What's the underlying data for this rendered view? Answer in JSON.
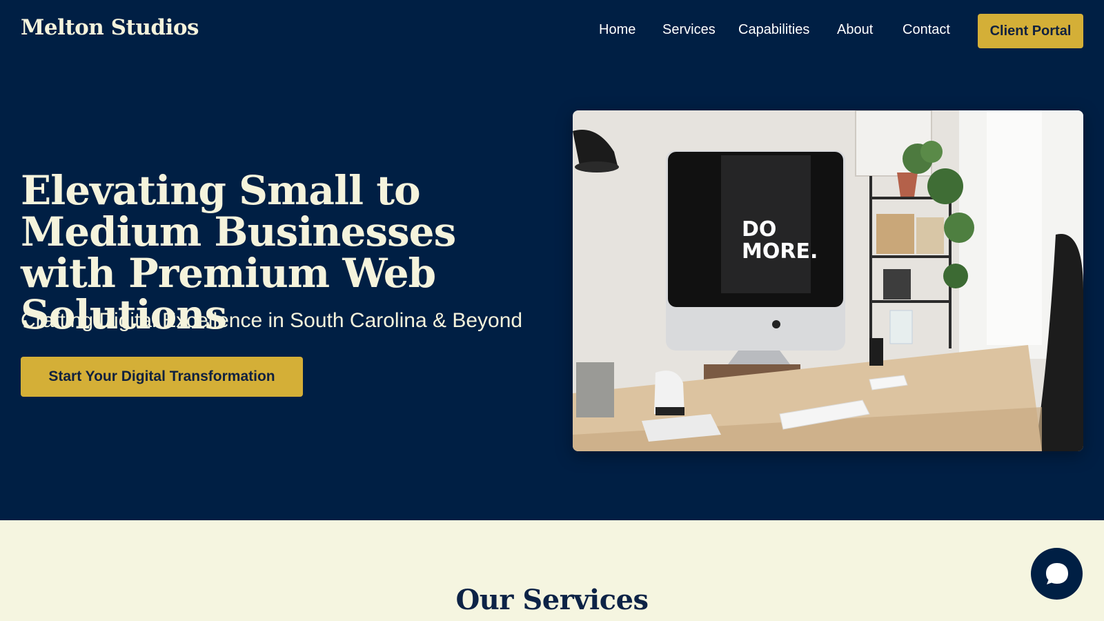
{
  "nav": {
    "brand": "Melton Studios",
    "links": [
      "Home",
      "Services",
      "Capabilities",
      "About",
      "Contact"
    ],
    "portal_button": "Client Portal"
  },
  "hero": {
    "title": "Elevating Small to Medium Businesses with Premium Web Solutions",
    "subtitle": "Crafting Digital Excellence in South Carolina & Beyond",
    "cta": "Start Your Digital Transformation",
    "image_screen_text": "DO MORE."
  },
  "services": {
    "heading": "Our Services"
  },
  "chat": {
    "icon": "chat-bubble-icon"
  },
  "colors": {
    "navy": "#001f44",
    "gold": "#d4af37",
    "cream": "#f5f3dc",
    "band": "#f5f5e0"
  }
}
